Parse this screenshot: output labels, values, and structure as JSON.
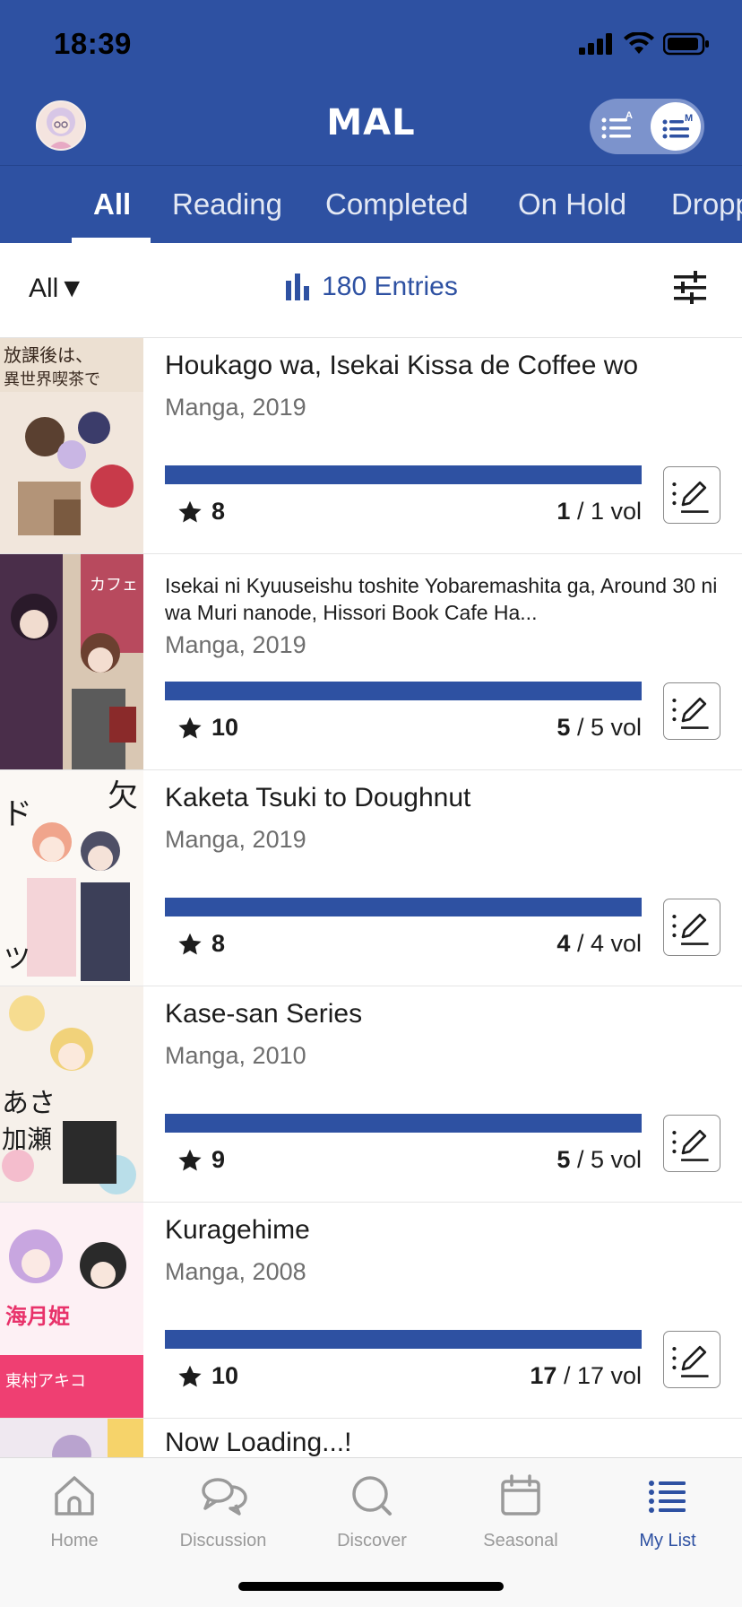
{
  "status_bar": {
    "time": "18:39"
  },
  "header": {
    "logo": "MAL"
  },
  "status_tabs": [
    {
      "label": "All",
      "active": true
    },
    {
      "label": "Reading",
      "active": false
    },
    {
      "label": "Completed",
      "active": false
    },
    {
      "label": "On Hold",
      "active": false
    },
    {
      "label": "Dropp",
      "active": false
    }
  ],
  "filter": {
    "type_selector": "All▼",
    "entries": "180 Entries"
  },
  "items": [
    {
      "title": "Houkago wa, Isekai Kissa de Coffee wo",
      "meta": "Manga, 2019",
      "score": "8",
      "vol_read": "1",
      "vol_total": "/ 1 vol",
      "progress": 1.0
    },
    {
      "title": "Isekai ni Kyuuseishu toshite Yobaremashita ga, Around 30 ni wa Muri nanode, Hissori Book Cafe Ha...",
      "meta": "Manga, 2019",
      "score": "10",
      "vol_read": "5",
      "vol_total": "/ 5 vol",
      "progress": 1.0
    },
    {
      "title": "Kaketa Tsuki to Doughnut",
      "meta": "Manga, 2019",
      "score": "8",
      "vol_read": "4",
      "vol_total": "/ 4 vol",
      "progress": 1.0
    },
    {
      "title": "Kase-san Series",
      "meta": "Manga, 2010",
      "score": "9",
      "vol_read": "5",
      "vol_total": "/ 5 vol",
      "progress": 1.0
    },
    {
      "title": "Kuragehime",
      "meta": "Manga, 2008",
      "score": "10",
      "vol_read": "17",
      "vol_total": "/ 17 vol",
      "progress": 1.0
    }
  ],
  "loading_text": "Now Loading...!",
  "tabbar": [
    {
      "label": "Home",
      "icon": "home-icon",
      "active": false
    },
    {
      "label": "Discussion",
      "icon": "discussion-icon",
      "active": false
    },
    {
      "label": "Discover",
      "icon": "discover-icon",
      "active": false
    },
    {
      "label": "Seasonal",
      "icon": "calendar-icon",
      "active": false
    },
    {
      "label": "My List",
      "icon": "list-icon",
      "active": true
    }
  ],
  "colors": {
    "brand": "#2e51a2",
    "inactive": "#9a9a9a"
  }
}
